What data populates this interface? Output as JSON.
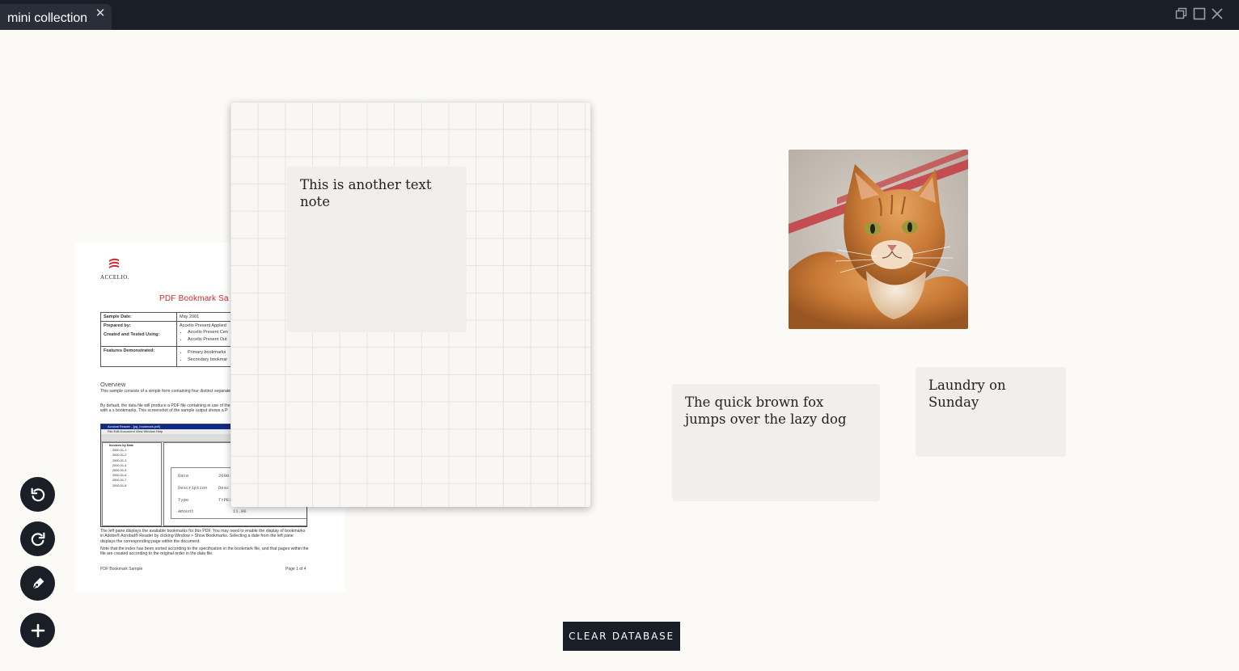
{
  "window": {
    "tab_title": "mini collection",
    "tab_close_icon": "close-icon",
    "controls": [
      "restore-icon",
      "maximize-icon",
      "close-icon"
    ]
  },
  "canvas": {
    "pdf_card": {
      "logo_text": "ACCELIO.",
      "title": "PDF Bookmark Sa",
      "table": [
        {
          "key": "Sample Date:",
          "value": "May 2001"
        },
        {
          "key": "Prepared by:",
          "value": "Accelio Present Applied"
        },
        {
          "key": "Created and Tested Using:",
          "items": [
            "Accelio Present Cen",
            "Accelio Present Out"
          ]
        },
        {
          "key": "Features Demonstrated:",
          "items": [
            "Primary bookmarks",
            "Secondary bookmar"
          ]
        }
      ],
      "overview_heading": "Overview",
      "overview_p1": "This sample consists of a simple form containing four distinct separate records.",
      "overview_p2": "By default, the data file will produce a PDF file containing ei use of the bookmark file will produce the same PDF with a s bookmarks. This screenshot of the sample output shows a P",
      "screenshot": {
        "window_title": "Acrobat Reader - [pg_bookmark.pdf]",
        "menu": "File  Edit  Document  View  Window  Help",
        "tree": [
          "Invoices by Date",
          "2000-01-1",
          "2000-01-2",
          "2000-01-3",
          "2000-01-4",
          "2000-01-5",
          "2000-01-6",
          "2000-01-7",
          "2000-01-8"
        ],
        "form": [
          {
            "label": "Date",
            "value": "2000-"
          },
          {
            "label": "Description",
            "value": "Desc"
          },
          {
            "label": "Type",
            "value": "TYPE1"
          },
          {
            "label": "Amount",
            "value": "11.00"
          }
        ]
      },
      "body_p1": "The left pane displays the available bookmarks for this PDF. You may need to enable the display of bookmarks in Adobe® Acrobat® Reader by clicking Window > Show Bookmarks. Selecting a date from the left pane displays the corresponding page within the document.",
      "body_p2": "Note that the index has been sorted according to the specification in the bookmark file, and that pages within the file are created according to the original order in the data file.",
      "footer_left": "PDF Bookmark Sample",
      "footer_right": "Page 1 of 4"
    },
    "notes": [
      {
        "text": "This is another text note"
      },
      {
        "text": "The quick brown fox jumps over the lazy dog"
      },
      {
        "text": "Laundry on Sunday"
      }
    ],
    "image_card": {
      "subject": "orange tabby cat"
    }
  },
  "toolbar": {
    "undo_icon": "undo-icon",
    "redo_icon": "redo-icon",
    "draw_icon": "pen-icon",
    "add_icon": "plus-icon"
  },
  "clear_button": {
    "label": "CLEAR DATABASE"
  },
  "colors": {
    "dark": "#1a1e27",
    "canvas_bg": "#fbfaf6",
    "note_bg": "#f0efeb",
    "pdf_title_red": "#d3262b"
  }
}
